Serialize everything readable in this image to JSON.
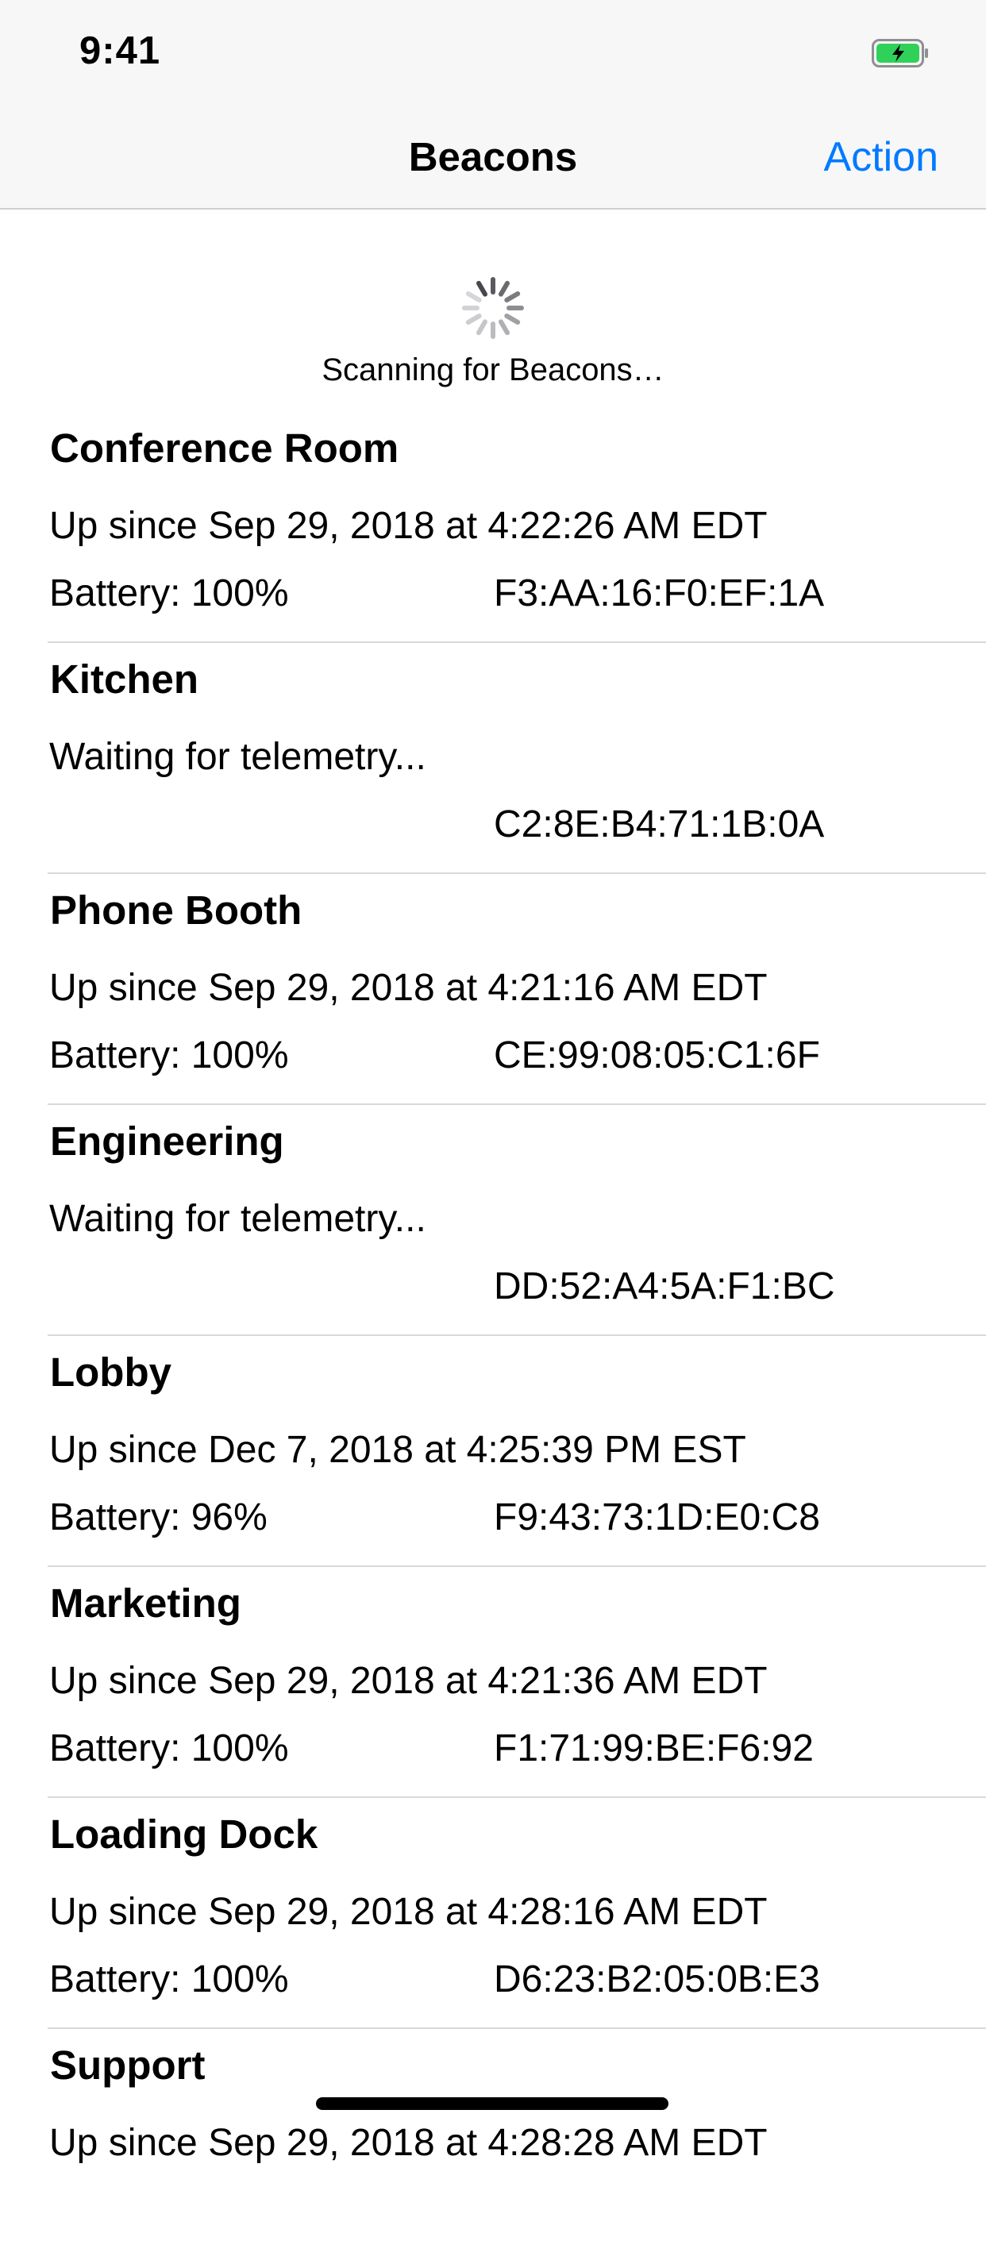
{
  "status_bar": {
    "time": "9:41"
  },
  "nav": {
    "title": "Beacons",
    "action_label": "Action"
  },
  "scan": {
    "text": "Scanning for Beacons…"
  },
  "beacons": [
    {
      "name": "Conference Room",
      "status": "Up since Sep 29, 2018 at 4:22:26 AM EDT",
      "battery": "Battery: 100%",
      "mac": "F3:AA:16:F0:EF:1A"
    },
    {
      "name": "Kitchen",
      "status": "Waiting for telemetry...",
      "battery": "",
      "mac": "C2:8E:B4:71:1B:0A"
    },
    {
      "name": "Phone Booth",
      "status": "Up since Sep 29, 2018 at 4:21:16 AM EDT",
      "battery": "Battery: 100%",
      "mac": "CE:99:08:05:C1:6F"
    },
    {
      "name": "Engineering",
      "status": "Waiting for telemetry...",
      "battery": "",
      "mac": "DD:52:A4:5A:F1:BC"
    },
    {
      "name": "Lobby",
      "status": "Up since Dec 7, 2018 at 4:25:39 PM EST",
      "battery": "Battery: 96%",
      "mac": "F9:43:73:1D:E0:C8"
    },
    {
      "name": "Marketing",
      "status": "Up since Sep 29, 2018 at 4:21:36 AM EDT",
      "battery": "Battery: 100%",
      "mac": "F1:71:99:BE:F6:92"
    },
    {
      "name": "Loading Dock",
      "status": "Up since Sep 29, 2018 at 4:28:16 AM EDT",
      "battery": "Battery: 100%",
      "mac": "D6:23:B2:05:0B:E3"
    },
    {
      "name": "Support",
      "status": "Up since Sep 29, 2018 at 4:28:28 AM EDT",
      "battery": "",
      "mac": ""
    }
  ],
  "colors": {
    "accent": "#007aff",
    "battery_fill": "#30d158",
    "separator": "#d9d9dc"
  },
  "icons": {
    "battery": "battery-charging-icon",
    "spinner": "activity-spinner-icon"
  }
}
